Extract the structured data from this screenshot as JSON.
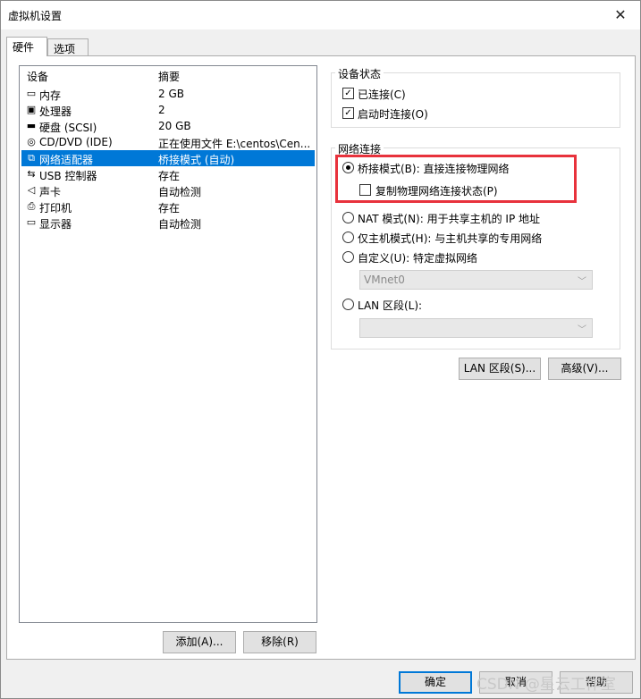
{
  "window": {
    "title": "虚拟机设置",
    "close_glyph": "✕"
  },
  "tabs": [
    {
      "label": "硬件"
    },
    {
      "label": "选项"
    }
  ],
  "device_list": {
    "headers": {
      "device": "设备",
      "summary": "摘要"
    },
    "rows": [
      {
        "icon": "memory-icon",
        "glyph": "▭",
        "name": "内存",
        "summary": "2 GB"
      },
      {
        "icon": "cpu-icon",
        "glyph": "▣",
        "name": "处理器",
        "summary": "2"
      },
      {
        "icon": "disk-icon",
        "glyph": "▬",
        "name": "硬盘 (SCSI)",
        "summary": "20 GB"
      },
      {
        "icon": "cdrom-icon",
        "glyph": "◎",
        "name": "CD/DVD (IDE)",
        "summary": "正在使用文件 E:\\centos\\Cen..."
      },
      {
        "icon": "network-adapter-icon",
        "glyph": "⧉",
        "name": "网络适配器",
        "summary": "桥接模式 (自动)",
        "selected": true
      },
      {
        "icon": "usb-icon",
        "glyph": "⇆",
        "name": "USB 控制器",
        "summary": "存在"
      },
      {
        "icon": "sound-icon",
        "glyph": "◁",
        "name": "声卡",
        "summary": "自动检测"
      },
      {
        "icon": "printer-icon",
        "glyph": "⎙",
        "name": "打印机",
        "summary": "存在"
      },
      {
        "icon": "display-icon",
        "glyph": "▭",
        "name": "显示器",
        "summary": "自动检测"
      }
    ],
    "add_label": "添加(A)...",
    "remove_label": "移除(R)"
  },
  "device_status": {
    "title": "设备状态",
    "connected": {
      "label": "已连接(C)",
      "checked": true
    },
    "connect_at_power_on": {
      "label": "启动时连接(O)",
      "checked": true
    }
  },
  "network_connection": {
    "title": "网络连接",
    "bridged": {
      "label": "桥接模式(B): 直接连接物理网络",
      "selected": true
    },
    "replicate": {
      "label": "复制物理网络连接状态(P)",
      "checked": false
    },
    "nat": {
      "label": "NAT 模式(N): 用于共享主机的 IP 地址"
    },
    "host_only": {
      "label": "仅主机模式(H): 与主机共享的专用网络"
    },
    "custom": {
      "label": "自定义(U): 特定虚拟网络"
    },
    "custom_select": "VMnet0",
    "lan_segment": {
      "label": "LAN 区段(L):"
    },
    "lan_select": ""
  },
  "buttons": {
    "lan_segments": "LAN 区段(S)...",
    "advanced": "高级(V)...",
    "ok": "确定",
    "cancel": "取消",
    "help": "帮助"
  },
  "watermark": "CSDN @星云工作室",
  "colors": {
    "selection": "#0078d7",
    "highlight_box": "#e8323c"
  }
}
